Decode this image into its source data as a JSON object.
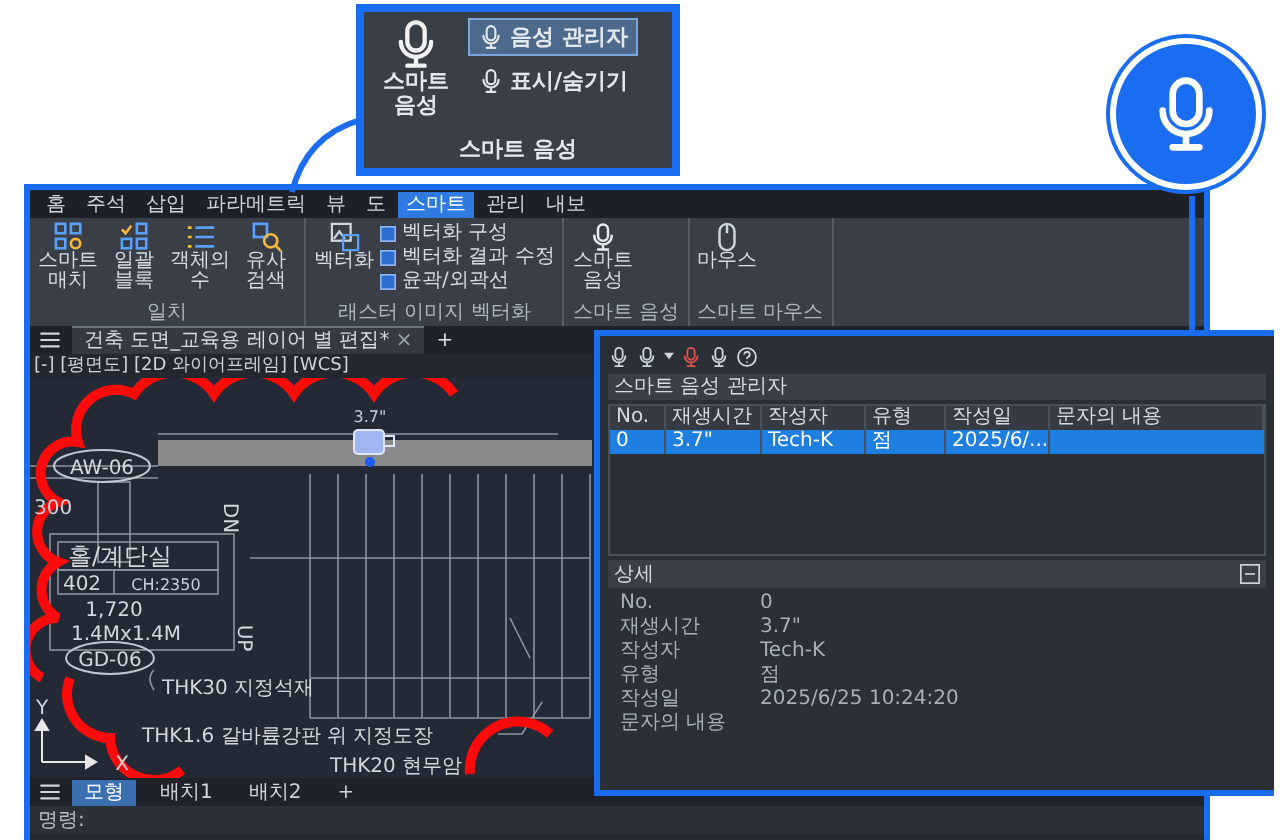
{
  "ribbon": {
    "tabs": [
      {
        "label": "홈",
        "selected": false
      },
      {
        "label": "주석",
        "selected": false
      },
      {
        "label": "삽입",
        "selected": false
      },
      {
        "label": "파라메트릭",
        "selected": false
      },
      {
        "label": "뷰",
        "selected": false
      },
      {
        "label": "도",
        "selected": false
      },
      {
        "label": "스마트",
        "selected": true
      },
      {
        "label": "관리",
        "selected": false
      },
      {
        "label": "내보",
        "selected": false
      }
    ],
    "groups": [
      {
        "label": "일치",
        "tools": [
          "스마트 매치",
          "일괄 블록",
          "객체의 수",
          "유사 검색"
        ]
      },
      {
        "label": "래스터 이미지 벡터화",
        "tools": [
          "벡터화"
        ],
        "items": [
          "벡터화 구성",
          "벡터화 결과 수정",
          "윤곽/외곽선"
        ]
      },
      {
        "label": "스마트 음성",
        "tools": [
          "스마트 음성"
        ]
      },
      {
        "label": "스마트 마우스",
        "tools": [
          "마우스"
        ]
      }
    ]
  },
  "document_tab": {
    "title": "건축 도면_교육용 레이어 별 편집*",
    "close": "×",
    "add": "+"
  },
  "viewport_label": "[-] [평면도] [2D 와이어프레임] [WCS]",
  "drawing": {
    "texts": [
      "3.7\"",
      "AW-06",
      "300",
      "홀/계단실",
      "402",
      "CH:2350",
      "1,720",
      "1.4Mx1.4M",
      "DN",
      "UP",
      "GD-06",
      "THK30 지정석재",
      "THK1.6 갈바륨강판 위 지정도장",
      "THK20 현무암",
      "Y",
      "X"
    ]
  },
  "layout_tabs": [
    {
      "label": "모형",
      "selected": true
    },
    {
      "label": "배치1",
      "selected": false
    },
    {
      "label": "배치2",
      "selected": false
    },
    {
      "label": "+",
      "selected": false
    }
  ],
  "command_line": {
    "label": "명령:"
  },
  "callout": {
    "big_button": "스마트 음성",
    "buttons": [
      {
        "label": "음성 관리자",
        "selected": true
      },
      {
        "label": "표시/숨기기",
        "selected": false
      }
    ],
    "group_label": "스마트 음성"
  },
  "voice_manager": {
    "title": "스마트 음성 관리자",
    "columns": [
      "No.",
      "재생시간",
      "작성자",
      "유형",
      "작성일",
      "문자의 내용"
    ],
    "rows": [
      {
        "cells": [
          "0",
          "3.7\"",
          "Tech-K",
          "점",
          "2025/6/..."
        ],
        "selected": true
      }
    ],
    "detail": {
      "title": "상세",
      "fields": [
        {
          "label": "No.",
          "value": "0"
        },
        {
          "label": "재생시간",
          "value": "3.7\""
        },
        {
          "label": "작성자",
          "value": "Tech-K"
        },
        {
          "label": "유형",
          "value": "점"
        },
        {
          "label": "작성일",
          "value": "2025/6/25 10:24:20"
        },
        {
          "label": "문자의 내용"
        }
      ]
    }
  }
}
